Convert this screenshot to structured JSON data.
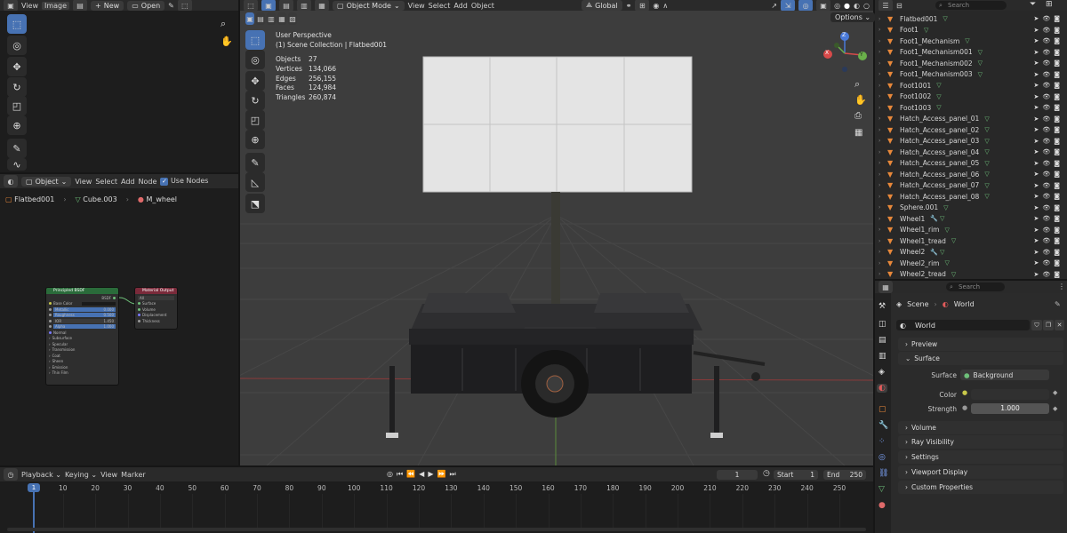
{
  "image_editor": {
    "menu": [
      "View",
      "Image"
    ],
    "new_label": "New",
    "open_label": "Open"
  },
  "node_editor": {
    "object_label": "Object",
    "menu": [
      "View",
      "Select",
      "Add",
      "Node"
    ],
    "use_nodes_label": "Use Nodes",
    "breadcrumb": [
      "Flatbed001",
      "Cube.003",
      "M_wheel"
    ],
    "bsdf": {
      "title": "Principled BSDF",
      "out": "BSDF",
      "rows": [
        "Base Color",
        "Metallic",
        "Roughness",
        "IOR",
        "Alpha"
      ],
      "values": [
        "0.000",
        "0.500",
        "1.450",
        "1.000"
      ],
      "sections": [
        "Normal",
        "Subsurface",
        "Specular",
        "Transmission",
        "Coat",
        "Sheen",
        "Emission",
        "Thin Film"
      ]
    },
    "output": {
      "title": "Material Output",
      "target": "All",
      "rows": [
        "Surface",
        "Volume",
        "Displacement",
        "Thickness"
      ]
    }
  },
  "viewport": {
    "mode_label": "Object Mode",
    "menu": [
      "View",
      "Select",
      "Add",
      "Object"
    ],
    "transform_label": "Global",
    "options_label": "Options",
    "perspective": "User Perspective",
    "collection": "(1) Scene Collection | Flatbed001",
    "stats": [
      {
        "k": "Objects",
        "v": "27"
      },
      {
        "k": "Vertices",
        "v": "134,066"
      },
      {
        "k": "Edges",
        "v": "256,155"
      },
      {
        "k": "Faces",
        "v": "124,984"
      },
      {
        "k": "Triangles",
        "v": "260,874"
      }
    ],
    "gizmo": {
      "z": "Z",
      "x": "X",
      "y": "Y"
    }
  },
  "outliner": {
    "search_placeholder": "Search",
    "items": [
      {
        "name": "Flatbed001",
        "icon": "mesh"
      },
      {
        "name": "Foot1",
        "icon": "mesh"
      },
      {
        "name": "Foot1_Mechanism",
        "icon": "mesh"
      },
      {
        "name": "Foot1_Mechanism001",
        "icon": "mesh"
      },
      {
        "name": "Foot1_Mechanism002",
        "icon": "mesh"
      },
      {
        "name": "Foot1_Mechanism003",
        "icon": "mesh"
      },
      {
        "name": "Foot1001",
        "icon": "mesh"
      },
      {
        "name": "Foot1002",
        "icon": "mesh"
      },
      {
        "name": "Foot1003",
        "icon": "mesh"
      },
      {
        "name": "Hatch_Access_panel_01",
        "icon": "mesh"
      },
      {
        "name": "Hatch_Access_panel_02",
        "icon": "mesh"
      },
      {
        "name": "Hatch_Access_panel_03",
        "icon": "mesh"
      },
      {
        "name": "Hatch_Access_panel_04",
        "icon": "mesh"
      },
      {
        "name": "Hatch_Access_panel_05",
        "icon": "mesh"
      },
      {
        "name": "Hatch_Access_panel_06",
        "icon": "mesh"
      },
      {
        "name": "Hatch_Access_panel_07",
        "icon": "mesh"
      },
      {
        "name": "Hatch_Access_panel_08",
        "icon": "mesh"
      },
      {
        "name": "Sphere.001",
        "icon": "mesh"
      },
      {
        "name": "Wheel1",
        "icon": "wrench"
      },
      {
        "name": "Wheel1_rim",
        "icon": "mesh"
      },
      {
        "name": "Wheel1_tread",
        "icon": "mesh"
      },
      {
        "name": "Wheel2",
        "icon": "wrench"
      },
      {
        "name": "Wheel2_rim",
        "icon": "mesh"
      },
      {
        "name": "Wheel2_tread",
        "icon": "mesh"
      }
    ]
  },
  "properties": {
    "search_placeholder": "Search",
    "scene_label": "Scene",
    "world_label": "World",
    "world_name": "World",
    "panels": {
      "preview": "Preview",
      "surface": "Surface",
      "volume": "Volume",
      "ray_visibility": "Ray Visibility",
      "settings": "Settings",
      "viewport_display": "Viewport Display",
      "custom_properties": "Custom Properties"
    },
    "surface_field": "Surface",
    "surface_value": "Background",
    "color_field": "Color",
    "strength_field": "Strength",
    "strength_value": "1.000"
  },
  "timeline": {
    "menu": [
      "Playback",
      "Keying",
      "View",
      "Marker"
    ],
    "current_frame": "1",
    "start_label": "Start",
    "start_value": "1",
    "end_label": "End",
    "end_value": "250",
    "ticks": [
      "1",
      "10",
      "20",
      "30",
      "40",
      "50",
      "60",
      "70",
      "80",
      "90",
      "100",
      "110",
      "120",
      "130",
      "140",
      "150",
      "160",
      "170",
      "180",
      "190",
      "200",
      "210",
      "220",
      "230",
      "240",
      "250"
    ]
  },
  "colors": {
    "accent": "#4772b3",
    "header": "#2a2a2a",
    "viewport_bg": "#3d3d3d",
    "object_orange": "#e8883a",
    "mesh_green": "#6ec07a"
  }
}
